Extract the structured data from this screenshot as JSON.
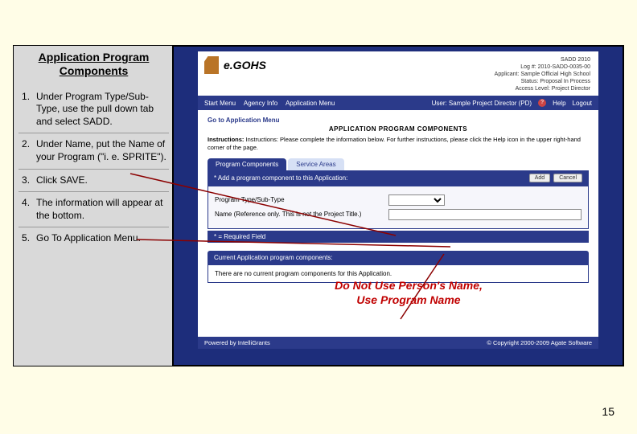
{
  "left": {
    "title_l1": "Application Program",
    "title_l2": "Components",
    "steps": [
      "Under Program Type/Sub-Type, use the pull down tab and select SADD.",
      "Under Name, put the Name of your Program (\"i. e. SPRITE\").",
      "Click SAVE.",
      "The information will appear at the bottom.",
      "Go To Application Menu."
    ],
    "bold_leads": [
      "SADD.",
      "SPRITE\").",
      "SAVE.",
      null,
      null
    ]
  },
  "app": {
    "logo_text": "e.GOHS",
    "meta": {
      "l1": "SADD 2010",
      "l2": "Log #: 2010-SADD-0035-00",
      "l3": "Applicant: Sample Official High School",
      "l4": "Status: Proposal In Process",
      "l5": "Access Level: Project Director"
    },
    "nav": {
      "left": [
        "Start Menu",
        "Agency Info",
        "Application Menu"
      ],
      "user_label": "User: Sample Project Director (PD)",
      "help": "Help",
      "logout": "Logout"
    },
    "goto": "Go to Application Menu",
    "heading": "APPLICATION PROGRAM COMPONENTS",
    "instructions": "Instructions: Please complete the information below. For further instructions, please click the Help icon in the upper right-hand corner of the page.",
    "tabs": {
      "active": "Program Components",
      "inactive": "Service Areas"
    },
    "panel_title": "* Add a program component to this Application:",
    "buttons": {
      "add": "Add",
      "cancel": "Cancel"
    },
    "form": {
      "type_label": "Program Type/Sub-Type",
      "name_label": "Name (Reference only. This is not the Project Title.)"
    },
    "req_note": "* = Required Field",
    "cap_head": "Current Application program components:",
    "cap_body": "There are no current program components for this Application.",
    "footer": {
      "left": "Powered by IntelliGrants",
      "right": "© Copyright 2000-2009 Agate Software"
    }
  },
  "warn": {
    "l1": "Do Not Use Person's Name,",
    "l2": "Use Program Name"
  },
  "page_number": "15"
}
